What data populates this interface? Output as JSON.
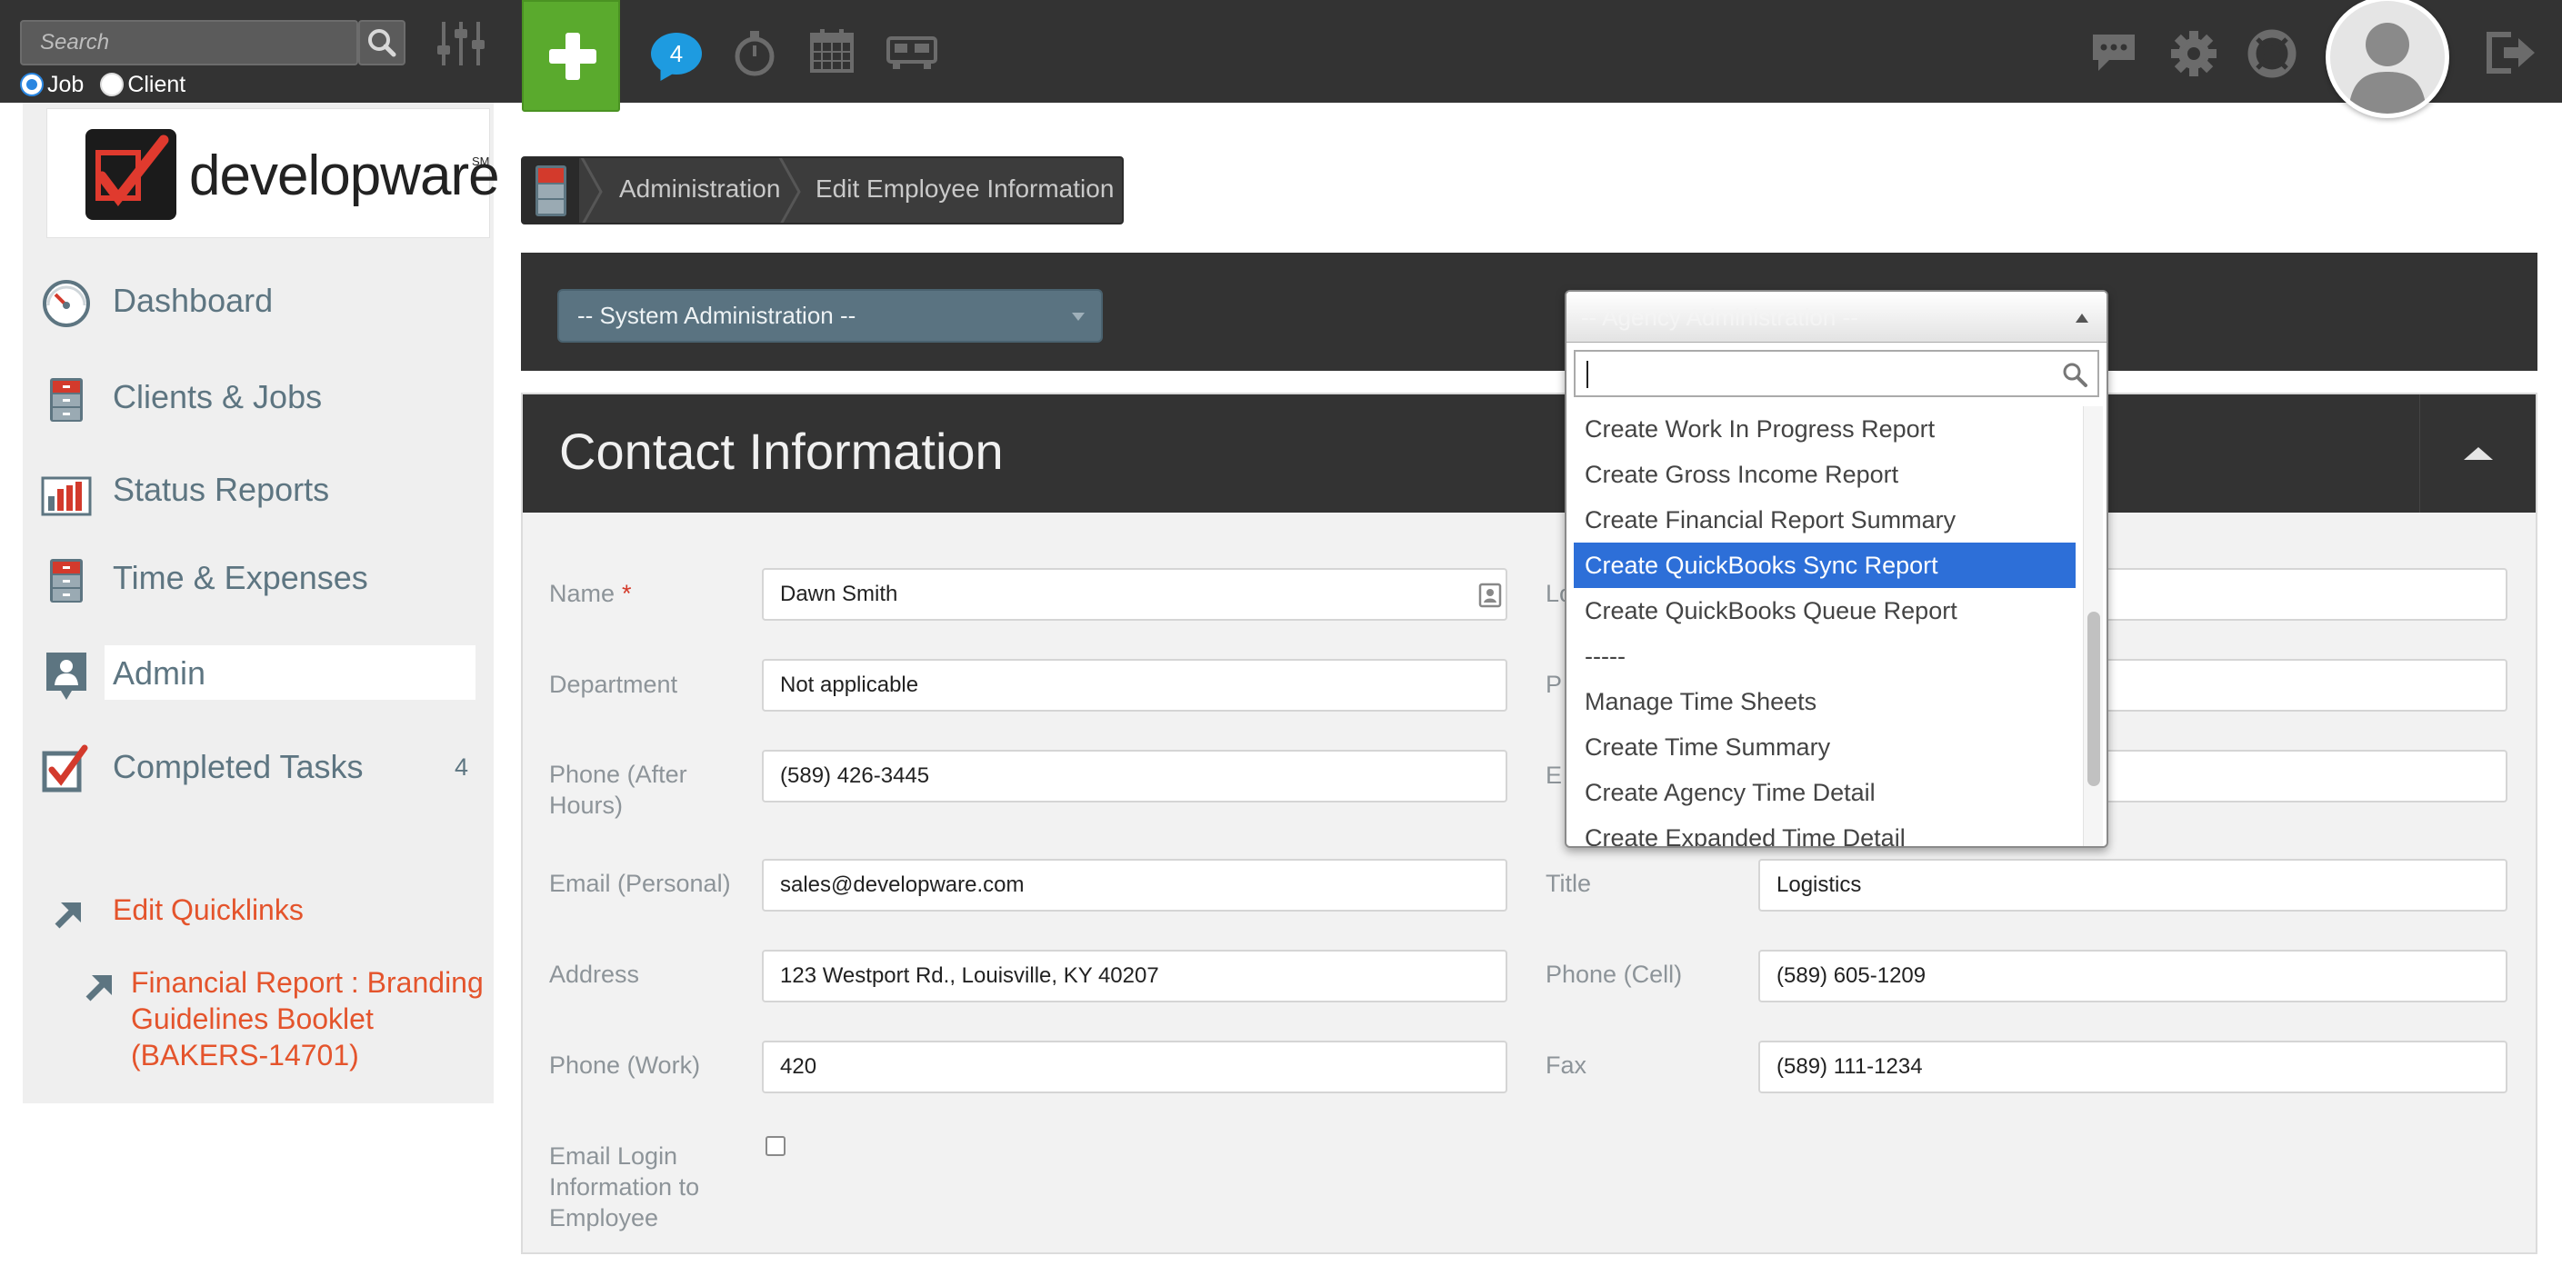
{
  "topbar": {
    "search_placeholder": "Search",
    "radio_job": "Job",
    "radio_client": "Client",
    "notification_count": "4"
  },
  "sidebar": {
    "logo_text": "developware",
    "logo_trademark": "SM",
    "nav": [
      {
        "label": "Dashboard",
        "icon": "dashboard-gauge-icon"
      },
      {
        "label": "Clients & Jobs",
        "icon": "file-cabinet-icon"
      },
      {
        "label": "Status Reports",
        "icon": "bar-chart-icon"
      },
      {
        "label": "Time & Expenses",
        "icon": "file-cabinet-icon"
      },
      {
        "label": "Admin",
        "icon": "admin-badge-icon",
        "active": true
      },
      {
        "label": "Completed Tasks",
        "icon": "checkbox-icon",
        "count": "4"
      }
    ],
    "quicklinks_title": "Edit Quicklinks",
    "quicklink_line1": "Financial Report : Branding",
    "quicklink_line2": "Guidelines Booklet",
    "quicklink_line3": "(BAKERS-14701)"
  },
  "breadcrumb": {
    "item1": "Administration",
    "item2": "Edit Employee Information"
  },
  "selects": {
    "system_admin": "-- System Administration --",
    "agency_admin": "-- Agency Administration --"
  },
  "panel": {
    "title": "Contact Information",
    "fields": {
      "name_label": "Name",
      "name_required": "*",
      "name_value": "Dawn Smith",
      "department_label": "Department",
      "department_value": "Not applicable",
      "phone_after_hours_label_1": "Phone (After",
      "phone_after_hours_label_2": "Hours)",
      "phone_after_hours_value": "(589) 426-3445",
      "email_personal_label": "Email (Personal)",
      "email_personal_value": "sales@developware.com",
      "address_label": "Address",
      "address_value": "123 Westport Rd., Louisville, KY 40207",
      "phone_work_label": "Phone (Work)",
      "phone_work_value": "420",
      "email_login_label_1": "Email Login",
      "email_login_label_2": "Information to",
      "email_login_label_3": "Employee",
      "right_label_1_partial": "Lo",
      "right_label_2_partial": "P",
      "right_label_3_partial": "E",
      "title_label": "Title",
      "title_value": "Logistics",
      "phone_cell_label": "Phone (Cell)",
      "phone_cell_value": "(589) 605-1209",
      "fax_label": "Fax",
      "fax_value": "(589) 111-1234"
    }
  },
  "dropdown": {
    "options": [
      "Create Work In Progress Report",
      "Create Gross Income Report",
      "Create Financial Report Summary",
      "Create QuickBooks Sync Report",
      "Create QuickBooks Queue Report",
      "-----",
      "Manage Time Sheets",
      "Create Time Summary",
      "Create Agency Time Detail",
      "Create Expanded Time Detail"
    ],
    "selected_index": 3
  },
  "colors": {
    "topbar": "#333333",
    "accent_green": "#5aaa2d",
    "badge_blue": "#1e9be0",
    "nav_text": "#5d7581",
    "quicklink": "#e4542c",
    "selected_option": "#2d6fd8"
  }
}
